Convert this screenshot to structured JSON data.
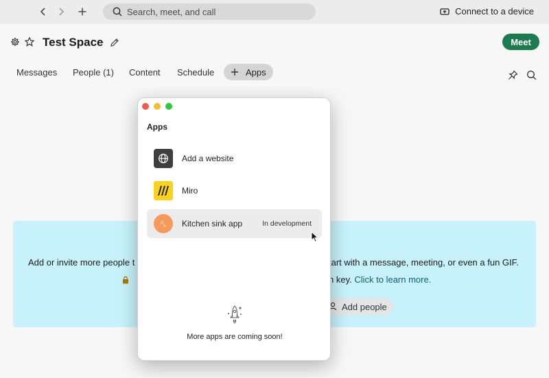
{
  "topbar": {
    "search_placeholder": "Search, meet, and call",
    "connect_label": "Connect to a device"
  },
  "header": {
    "title": "Test Space",
    "meet_label": "Meet"
  },
  "tabs": [
    {
      "label": "Messages"
    },
    {
      "label": "People (1)"
    },
    {
      "label": "Content"
    },
    {
      "label": "Schedule"
    },
    {
      "label": "Apps",
      "active": true
    }
  ],
  "banner": {
    "text_left": "Add or invite more people t",
    "text_right": "tart with a message, meeting, or even a fun GIF.",
    "secure_text": "n key.",
    "learn_link": "Click to learn more.",
    "add_people_label": "Add people"
  },
  "apps_popup": {
    "title": "Apps",
    "items": [
      {
        "label": "Add a website",
        "icon": "globe-icon"
      },
      {
        "label": "Miro",
        "icon": "miro-logo-icon"
      },
      {
        "label": "Kitchen sink app",
        "icon": "kitchen-sink-icon",
        "badge": "In development"
      }
    ],
    "footer_text": "More apps are coming soon!"
  },
  "colors": {
    "meet_button": "#1d7b50",
    "banner_bg": "#c7f2fb",
    "miro_yellow": "#f8d21d",
    "kitchen_orange": "#f59a5a"
  }
}
